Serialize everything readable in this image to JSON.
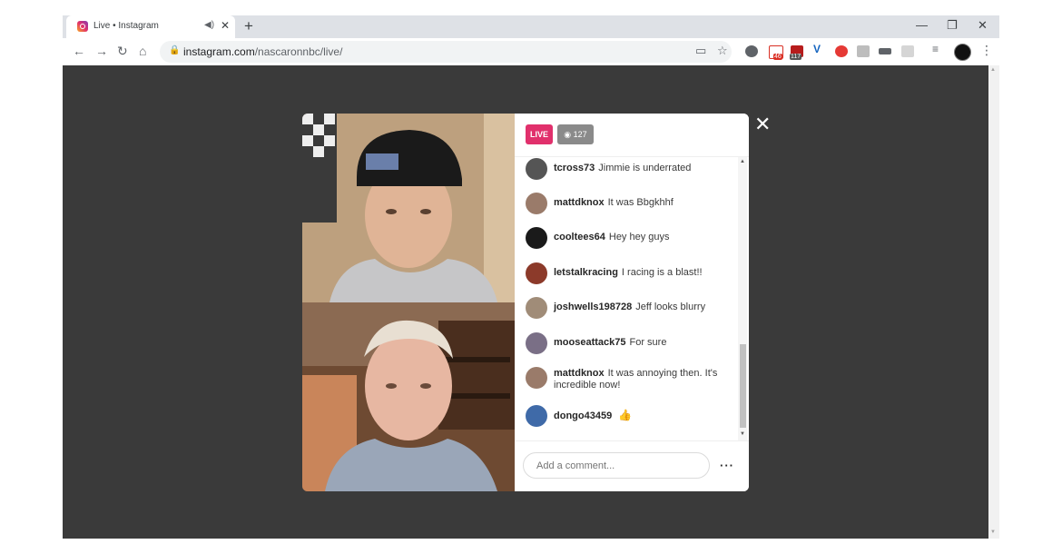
{
  "tab": {
    "title": "Live • Instagram"
  },
  "address": {
    "domain": "instagram.com",
    "path": "/nascaronnbc/live/"
  },
  "icons": [
    "back-icon",
    "forward-icon",
    "reload-icon",
    "home-icon",
    "lock-icon",
    "cast-icon",
    "star-icon",
    "minimize-icon",
    "restore-icon",
    "close-icon",
    "audio-icon",
    "menu-icon"
  ],
  "extensions": {
    "gmail_count": "46",
    "calendar_count": "117"
  },
  "live": {
    "badge": "LIVE",
    "viewer_count": "127"
  },
  "comments": [
    {
      "user": "tcross73",
      "text": "Jimmie is underrated"
    },
    {
      "user": "mattdknox",
      "text": "It was Bbgkhhf"
    },
    {
      "user": "cooltees64",
      "text": "Hey hey guys"
    },
    {
      "user": "letstalkracing",
      "text": "I racing is a blast!!"
    },
    {
      "user": "joshwells198728",
      "text": "Jeff looks blurry"
    },
    {
      "user": "mooseattack75",
      "text": "For sure"
    },
    {
      "user": "mattdknox",
      "text": "It was annoying then. It's incredible now!"
    },
    {
      "user": "dongo43459",
      "text": ""
    }
  ],
  "comment_box": {
    "placeholder": "Add a comment..."
  },
  "colors": {
    "live": "#e1306c",
    "viewport": "#3a3a3a",
    "viewers_badge": "#8a8a8a"
  }
}
